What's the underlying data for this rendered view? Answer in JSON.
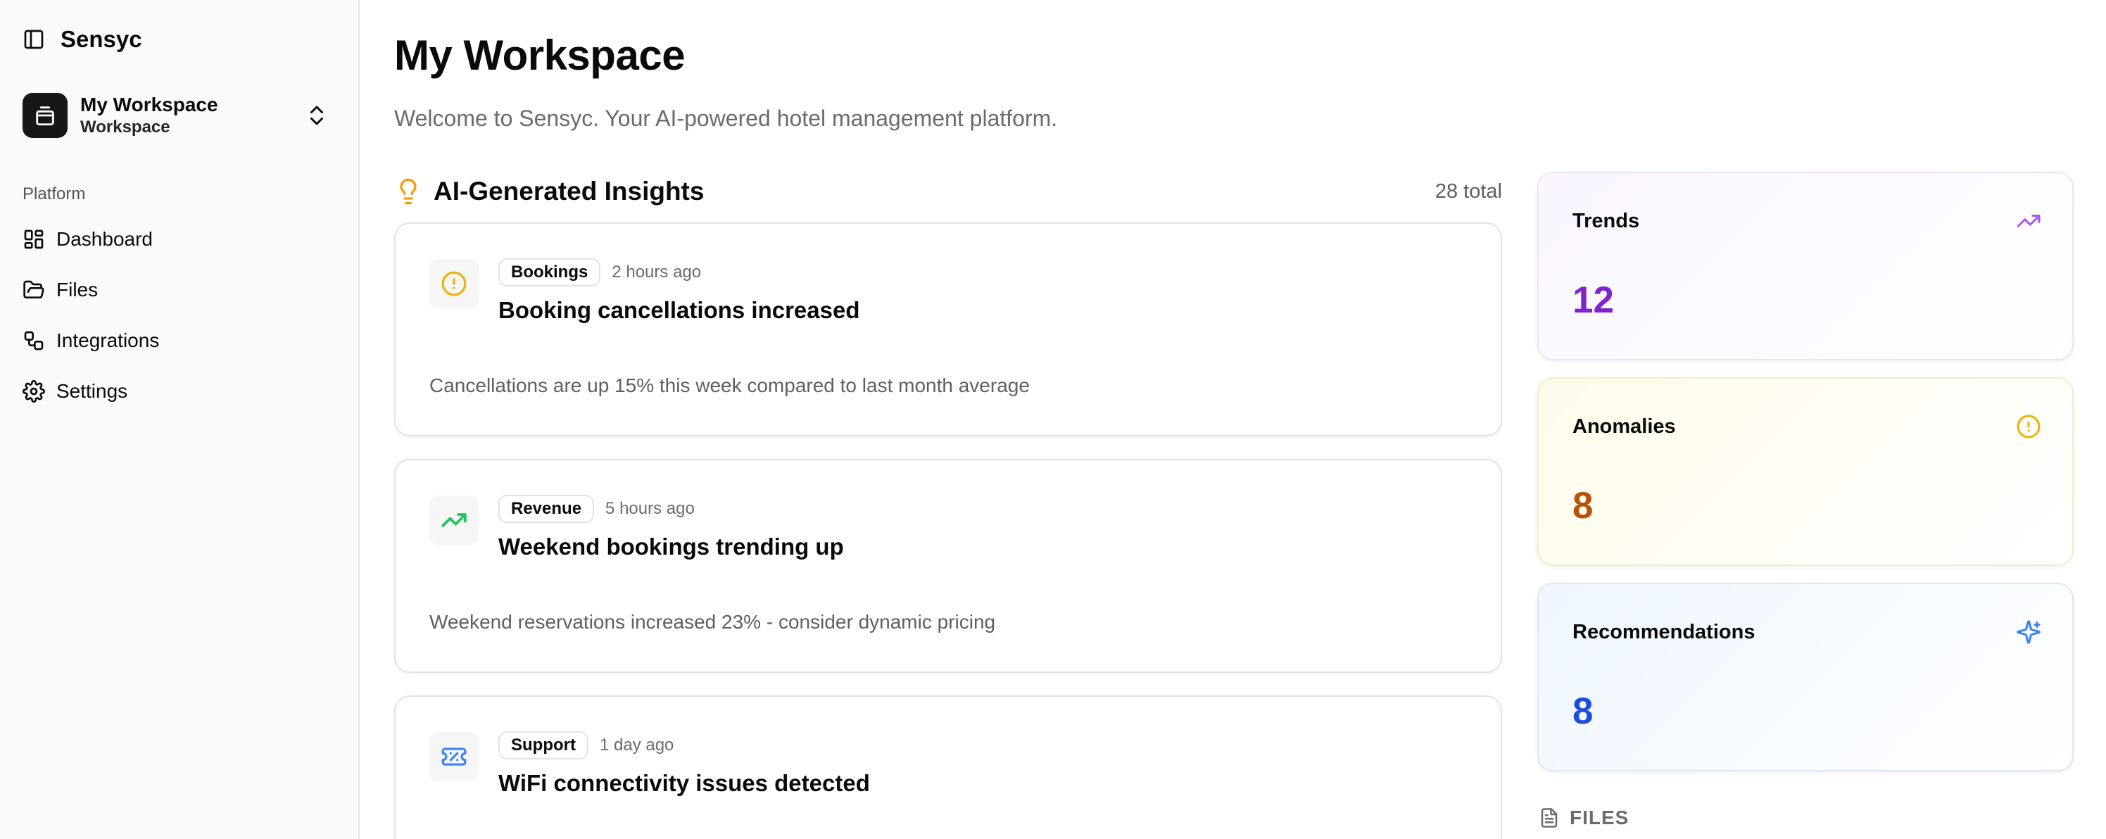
{
  "app": {
    "name": "Sensyc"
  },
  "workspace": {
    "name": "My Workspace",
    "subtitle": "Workspace"
  },
  "sidebar": {
    "group_label": "Platform",
    "items": [
      {
        "label": "Dashboard",
        "icon": "layout-dashboard-icon"
      },
      {
        "label": "Files",
        "icon": "folder-open-icon"
      },
      {
        "label": "Integrations",
        "icon": "workflow-icon"
      },
      {
        "label": "Settings",
        "icon": "settings-gear-icon"
      }
    ]
  },
  "main": {
    "title": "My Workspace",
    "subtitle": "Welcome to Sensyc. Your AI-powered hotel management platform.",
    "insights": {
      "title": "AI-Generated Insights",
      "total": "28 total",
      "items": [
        {
          "category": "Bookings",
          "time": "2 hours ago",
          "title": "Booking cancellations increased",
          "description": "Cancellations are up 15% this week compared to last month average",
          "icon": "alert-circle-icon",
          "icon_color": "#eab308"
        },
        {
          "category": "Revenue",
          "time": "5 hours ago",
          "title": "Weekend bookings trending up",
          "description": "Weekend reservations increased 23% - consider dynamic pricing",
          "icon": "trending-up-icon",
          "icon_color": "#22c55e"
        },
        {
          "category": "Support",
          "time": "1 day ago",
          "title": "WiFi connectivity issues detected",
          "description": "",
          "icon": "ticket-icon",
          "icon_color": "#3b82f6"
        }
      ]
    },
    "stats": {
      "trends": {
        "label": "Trends",
        "value": "12",
        "color": "#7e22ce",
        "icon": "trending-up-icon"
      },
      "anomalies": {
        "label": "Anomalies",
        "value": "8",
        "color": "#b45309",
        "icon": "alert-circle-icon"
      },
      "recommendations": {
        "label": "Recommendations",
        "value": "8",
        "color": "#1d4ed8",
        "icon": "sparkles-icon"
      }
    },
    "files_section": {
      "label": "FILES",
      "icon": "file-text-icon"
    }
  }
}
